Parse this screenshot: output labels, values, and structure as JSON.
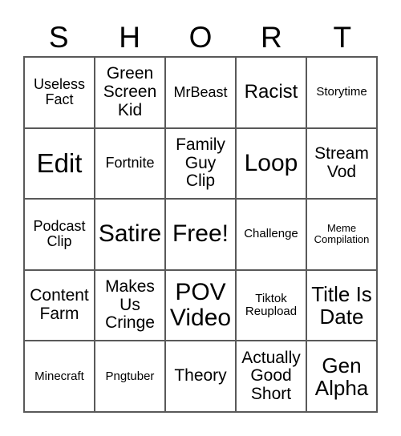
{
  "card": {
    "title_letters": [
      "S",
      "H",
      "O",
      "R",
      "T"
    ],
    "columns": 5,
    "rows": 5,
    "border_color": "#595959",
    "text_color": "#000000",
    "background_color": "#ffffff",
    "cells": [
      {
        "text": "Useless\nFact",
        "size": "md"
      },
      {
        "text": "Green\nScreen\nKid",
        "size": "lg"
      },
      {
        "text": "MrBeast",
        "size": "md"
      },
      {
        "text": "Racist",
        "size": "xl"
      },
      {
        "text": "Storytime",
        "size": "sm"
      },
      {
        "text": "Edit",
        "size": "4xl"
      },
      {
        "text": "Fortnite",
        "size": "md"
      },
      {
        "text": "Family\nGuy\nClip",
        "size": "lg"
      },
      {
        "text": "Loop",
        "size": "3xl"
      },
      {
        "text": "Stream\nVod",
        "size": "lg"
      },
      {
        "text": "Podcast\nClip",
        "size": "md"
      },
      {
        "text": "Satire",
        "size": "3xl"
      },
      {
        "text": "Free!",
        "size": "3xl"
      },
      {
        "text": "Challenge",
        "size": "sm"
      },
      {
        "text": "Meme\nCompilation",
        "size": "xs"
      },
      {
        "text": "Content\nFarm",
        "size": "lg"
      },
      {
        "text": "Makes\nUs\nCringe",
        "size": "lg"
      },
      {
        "text": "POV\nVideo",
        "size": "3xl"
      },
      {
        "text": "Tiktok\nReupload",
        "size": "sm"
      },
      {
        "text": "Title Is\nDate",
        "size": "2xl"
      },
      {
        "text": "Minecraft",
        "size": "sm"
      },
      {
        "text": "Pngtuber",
        "size": "sm"
      },
      {
        "text": "Theory",
        "size": "lg"
      },
      {
        "text": "Actually\nGood\nShort",
        "size": "lg"
      },
      {
        "text": "Gen\nAlpha",
        "size": "2xl"
      }
    ]
  }
}
